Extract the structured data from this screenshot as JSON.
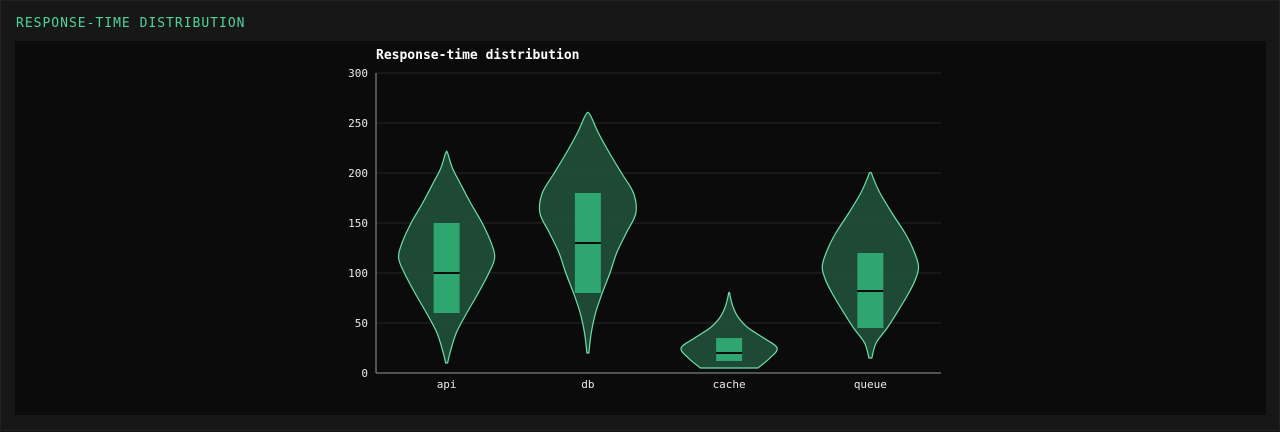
{
  "panel": {
    "title": "RESPONSE-TIME DISTRIBUTION"
  },
  "colors": {
    "accent": "#4fd39a",
    "violin_fill": "#1f4d38",
    "violin_stroke": "#6ee0a8",
    "box_fill": "#2fa570",
    "median": "#0b0b0b",
    "grid": "#262626",
    "axis": "#9a9a9a",
    "text": "#e8e8e8"
  },
  "chart_data": {
    "type": "violin",
    "title": "Response-time distribution",
    "xlabel": "",
    "ylabel": "",
    "ylim": [
      0,
      300
    ],
    "yticks": [
      0,
      50,
      100,
      150,
      200,
      250,
      300
    ],
    "grid": true,
    "categories": [
      "api",
      "db",
      "cache",
      "queue"
    ],
    "series": [
      {
        "category": "api",
        "min": 10,
        "max": 220,
        "q1": 60,
        "median": 100,
        "q3": 150,
        "density": [
          [
            10,
            0.02
          ],
          [
            20,
            0.07
          ],
          [
            40,
            0.2
          ],
          [
            60,
            0.42
          ],
          [
            80,
            0.66
          ],
          [
            100,
            0.88
          ],
          [
            115,
            1.0
          ],
          [
            130,
            0.93
          ],
          [
            150,
            0.74
          ],
          [
            170,
            0.5
          ],
          [
            190,
            0.28
          ],
          [
            205,
            0.12
          ],
          [
            220,
            0.02
          ]
        ]
      },
      {
        "category": "db",
        "min": 20,
        "max": 260,
        "q1": 80,
        "median": 130,
        "q3": 180,
        "density": [
          [
            20,
            0.02
          ],
          [
            40,
            0.07
          ],
          [
            60,
            0.16
          ],
          [
            80,
            0.3
          ],
          [
            100,
            0.46
          ],
          [
            120,
            0.6
          ],
          [
            140,
            0.8
          ],
          [
            160,
            1.0
          ],
          [
            180,
            0.95
          ],
          [
            200,
            0.7
          ],
          [
            220,
            0.45
          ],
          [
            240,
            0.22
          ],
          [
            255,
            0.08
          ],
          [
            260,
            0.02
          ]
        ]
      },
      {
        "category": "cache",
        "min": 5,
        "max": 80,
        "q1": 12,
        "median": 20,
        "q3": 35,
        "density": [
          [
            5,
            0.6
          ],
          [
            15,
            0.85
          ],
          [
            25,
            1.0
          ],
          [
            35,
            0.72
          ],
          [
            45,
            0.4
          ],
          [
            55,
            0.2
          ],
          [
            65,
            0.09
          ],
          [
            75,
            0.03
          ],
          [
            80,
            0.01
          ]
        ]
      },
      {
        "category": "queue",
        "min": 15,
        "max": 200,
        "q1": 45,
        "median": 82,
        "q3": 120,
        "density": [
          [
            15,
            0.03
          ],
          [
            30,
            0.12
          ],
          [
            45,
            0.35
          ],
          [
            60,
            0.55
          ],
          [
            80,
            0.8
          ],
          [
            95,
            0.95
          ],
          [
            108,
            1.0
          ],
          [
            125,
            0.88
          ],
          [
            140,
            0.72
          ],
          [
            160,
            0.45
          ],
          [
            180,
            0.2
          ],
          [
            195,
            0.06
          ],
          [
            200,
            0.02
          ]
        ]
      }
    ]
  }
}
